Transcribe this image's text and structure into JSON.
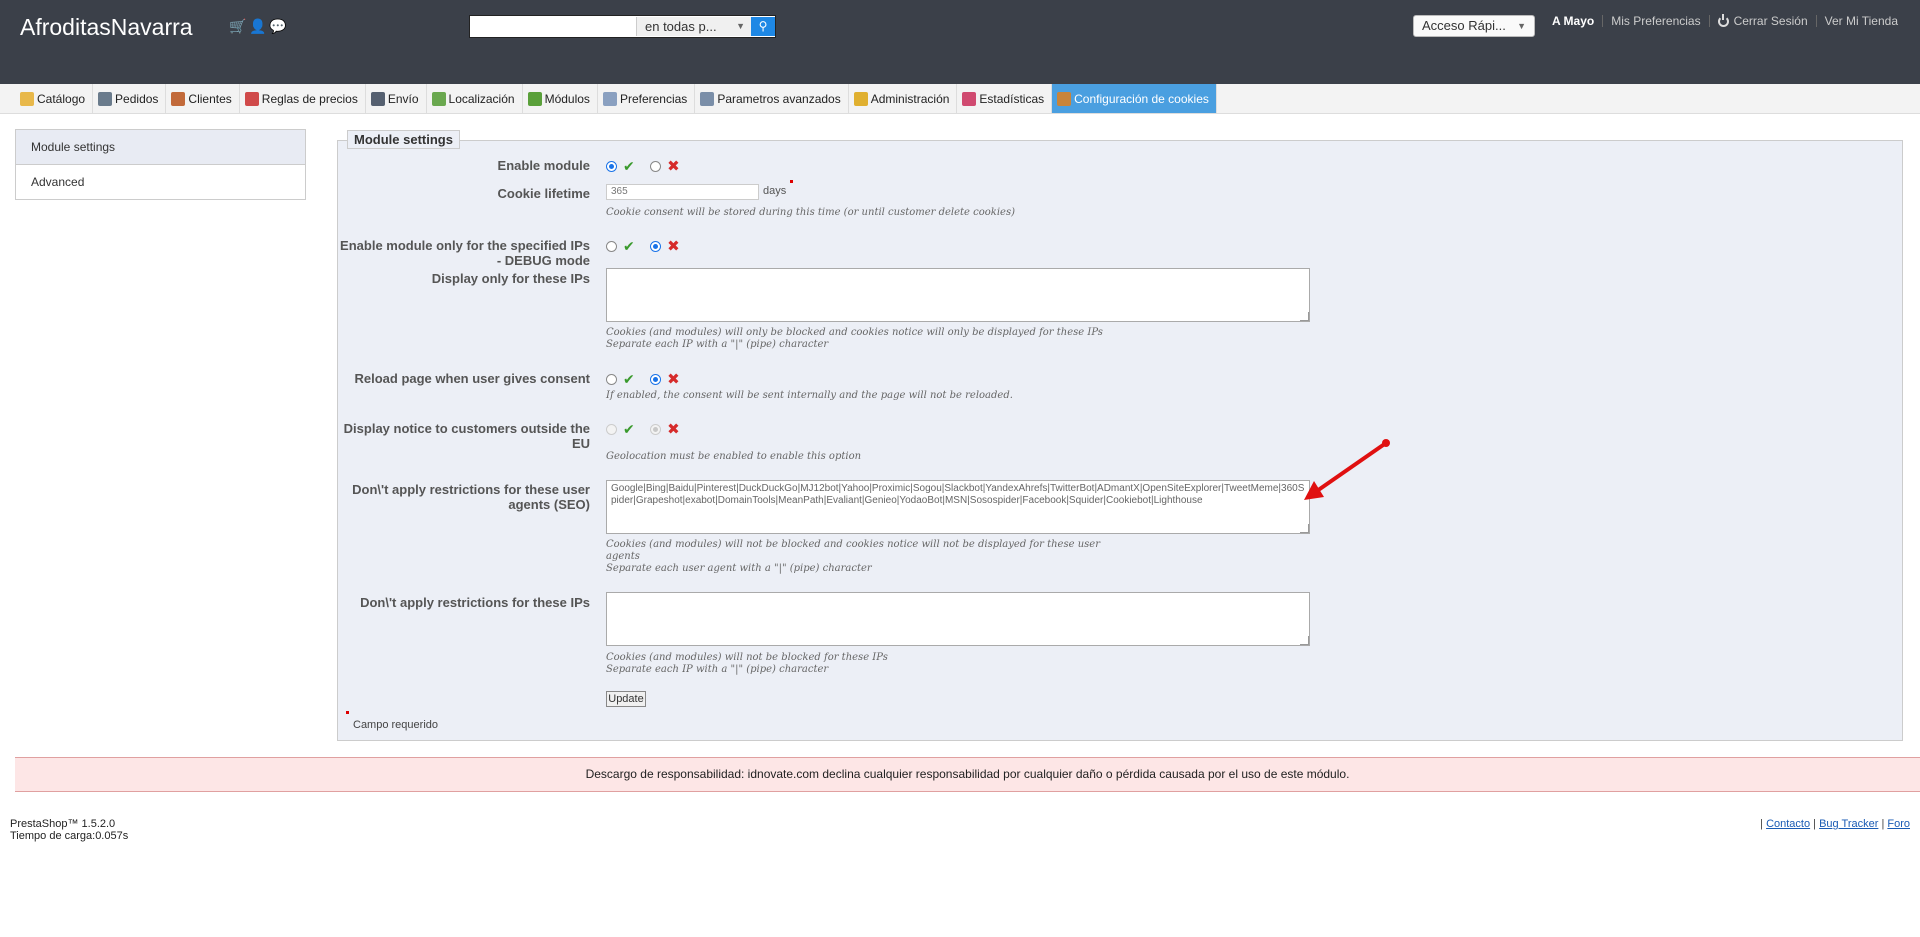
{
  "header": {
    "shop_name": "AfroditasNavarra",
    "search": {
      "placeholder": "",
      "scope": "en todas p..."
    },
    "quick_access": "Acceso Rápi...",
    "user": "A Mayo",
    "preferences": "Mis Preferencias",
    "logout": "Cerrar Sesión",
    "view_store": "Ver Mi Tienda"
  },
  "tabs": [
    {
      "label": "Catálogo",
      "icon": "folder-icon",
      "color": "#e8b84a"
    },
    {
      "label": "Pedidos",
      "icon": "cart-icon",
      "color": "#6a7b8c"
    },
    {
      "label": "Clientes",
      "icon": "user-icon",
      "color": "#c26a3a"
    },
    {
      "label": "Reglas de precios",
      "icon": "price-rules-icon",
      "color": "#d04a4a"
    },
    {
      "label": "Envío",
      "icon": "truck-icon",
      "color": "#556070"
    },
    {
      "label": "Localización",
      "icon": "globe-icon",
      "color": "#6aa84f"
    },
    {
      "label": "Módulos",
      "icon": "puzzle-icon",
      "color": "#5aa03a"
    },
    {
      "label": "Preferencias",
      "icon": "preferences-icon",
      "color": "#8aa0c0"
    },
    {
      "label": "Parametros avanzados",
      "icon": "wrench-icon",
      "color": "#7a8ea8"
    },
    {
      "label": "Administración",
      "icon": "key-icon",
      "color": "#e0b030"
    },
    {
      "label": "Estadísticas",
      "icon": "bar-chart-icon",
      "color": "#d04a70"
    },
    {
      "label": "Configuración de cookies",
      "icon": "cookie-icon",
      "color": "#c8843a"
    }
  ],
  "sidebar": {
    "items": [
      {
        "label": "Module settings"
      },
      {
        "label": "Advanced"
      }
    ]
  },
  "form": {
    "legend": "Module settings",
    "enable_module": {
      "label": "Enable module"
    },
    "cookie_lifetime": {
      "label": "Cookie lifetime",
      "value": "365",
      "unit": "days",
      "hint": "Cookie consent will be stored during this time (or until customer delete cookies)"
    },
    "debug_mode": {
      "label": "Enable module only for the specified IPs - DEBUG mode"
    },
    "debug_ips": {
      "label": "Display only for these IPs",
      "value": "",
      "hint1": "Cookies (and modules) will only be blocked and cookies notice will only be displayed for these IPs",
      "hint2": "Separate each IP with a \"|\" (pipe) character"
    },
    "reload_page": {
      "label": "Reload page when user gives consent",
      "hint": "If enabled, the consent will be sent internally and the page will not be reloaded."
    },
    "outside_eu": {
      "label": "Display notice to customers outside the EU",
      "hint": "Geolocation must be enabled to enable this option"
    },
    "user_agents": {
      "label": "Don\\'t apply restrictions for these user agents (SEO)",
      "value": "Google|Bing|Baidu|Pinterest|DuckDuckGo|MJ12bot|Yahoo|Proximic|Sogou|Slackbot|YandexAhrefs|TwitterBot|ADmantX|OpenSiteExplorer|TweetMeme|360Spider|Grapeshot|exabot|DomainTools|MeanPath|Evaliant|Genieo|YodaoBot|MSN|Sosospider|Facebook|Squider|Cookiebot|Lighthouse",
      "hint1": "Cookies (and modules) will not be blocked and cookies notice will not be displayed for these user",
      "hint1b": "agents",
      "hint2": "Separate each user agent with a \"|\" (pipe) character"
    },
    "ips": {
      "label": "Don\\'t apply restrictions for these IPs",
      "value": "",
      "hint1": "Cookies (and modules) will not be blocked for these IPs",
      "hint2": "Separate each IP with a \"|\" (pipe) character"
    },
    "update_label": "Update",
    "required_note": "Campo requerido"
  },
  "disclaimer": "Descargo de responsabilidad: idnovate.com declina cualquier responsabilidad por cualquier daño o pérdida causada por el uso de este módulo.",
  "footer": {
    "version": "PrestaShop™ 1.5.2.0",
    "load_time": "Tiempo de carga:0.057s",
    "links": [
      "Contacto",
      "Bug Tracker",
      "Foro"
    ]
  },
  "colors": {
    "header_bg": "#3b4049",
    "active_tab": "#4a9fe0",
    "panel_bg": "#eceff6",
    "disclaimer_bg": "#fde6e6",
    "annotation_arrow": "#e01010"
  }
}
